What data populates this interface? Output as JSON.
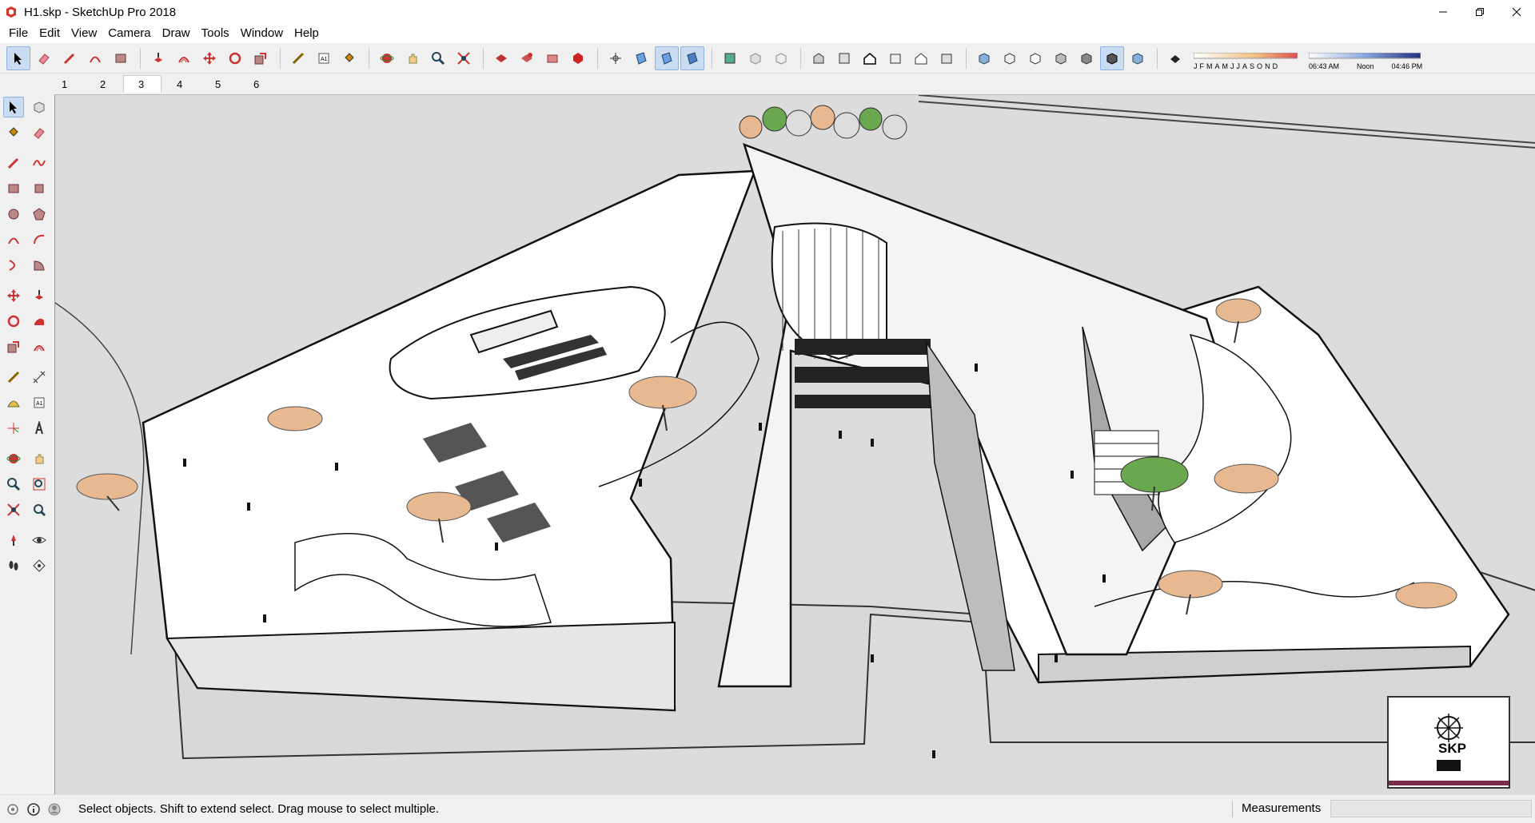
{
  "window": {
    "title": "H1.skp - SketchUp Pro 2018",
    "app_icon": "sketchup-icon",
    "controls": [
      "minimize-icon",
      "restore-icon",
      "close-icon"
    ]
  },
  "menu": [
    "File",
    "Edit",
    "View",
    "Camera",
    "Draw",
    "Tools",
    "Window",
    "Help"
  ],
  "shadow_settings": {
    "months": [
      "J",
      "F",
      "M",
      "A",
      "M",
      "J",
      "J",
      "A",
      "S",
      "O",
      "N",
      "D"
    ],
    "time_start": "06:43 AM",
    "time_mid": "Noon",
    "time_end": "04:46 PM"
  },
  "scenes": {
    "tabs": [
      "1",
      "2",
      "3",
      "4",
      "5",
      "6"
    ],
    "active": "3"
  },
  "viewport": {
    "logo_text": "SKP"
  },
  "status": {
    "message": "Select objects. Shift to extend select. Drag mouse to select multiple.",
    "measurements_label": "Measurements",
    "measurements_value": ""
  },
  "colors": {
    "accent": "#c9dcf2",
    "sketchup_red": "#d03a2a",
    "model_fill": "#ffffff",
    "background": "#dcdcdc",
    "tree_orange": "#e8b890",
    "tree_green": "#6aa84f"
  }
}
